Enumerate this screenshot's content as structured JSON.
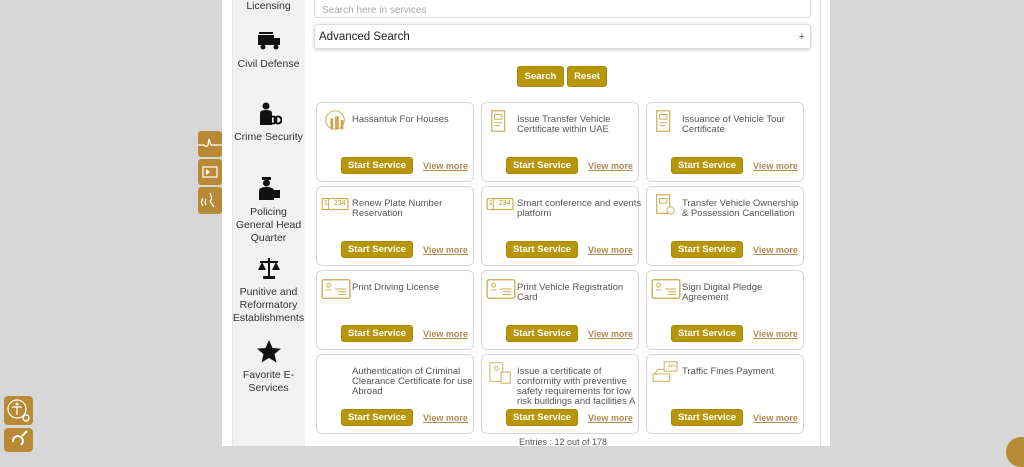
{
  "sidebar": {
    "items": [
      {
        "label": "Licensing",
        "icon": "licensing-icon"
      },
      {
        "label": "Civil Defense",
        "icon": "fire-truck-icon"
      },
      {
        "label": "Crime Security",
        "icon": "police-handcuffs-icon"
      },
      {
        "label": "Policing General Head Quarter",
        "icon": "police-officer-icon"
      },
      {
        "label": "Punitive and Reformatory Establishments",
        "icon": "scales-icon"
      },
      {
        "label": "Favorite E-Services",
        "icon": "star-icon"
      }
    ]
  },
  "search": {
    "placeholder": "Search here in services",
    "advanced_label": "Advanced Search",
    "expand_symbol": "+",
    "search_label": "Search",
    "reset_label": "Reset"
  },
  "services": [
    {
      "title": "Hassantuk For Houses",
      "icon": "hassantuk-icon"
    },
    {
      "title": "Issue Transfer Vehicle Certificate within UAE",
      "icon": "vehicle-certificate-icon"
    },
    {
      "title": "Issuance of Vehicle Tour Certificate",
      "icon": "vehicle-certificate-icon"
    },
    {
      "title": "Renew Plate Number Reservation",
      "icon": "plate-number-icon"
    },
    {
      "title": "Smart conference and events platform",
      "icon": "plate-number-icon"
    },
    {
      "title": "Transfer Vehicle Ownership & Possession Cancellation",
      "icon": "vehicle-ownership-icon"
    },
    {
      "title": "Print Driving License",
      "icon": "id-card-icon"
    },
    {
      "title": "Print Vehicle Registration Card",
      "icon": "id-card-icon"
    },
    {
      "title": "Sign Digital Pledge Agreement",
      "icon": "id-card-icon"
    },
    {
      "title": "Authentication of Criminal Clearance Certificate for use Abroad",
      "icon": ""
    },
    {
      "title": "Issue a certificate of conformity with preventive safety requirements for low risk buildings and facilities A",
      "icon": "building-certificate-icon"
    },
    {
      "title": "Traffic Fines Payment",
      "icon": "traffic-fines-icon"
    }
  ],
  "card_labels": {
    "start": "Start Service",
    "more": "View more",
    "plate": "1 234",
    "aed": "AED"
  },
  "entries": "Entries : 12 out of 178",
  "colors": {
    "accent": "#b8960a",
    "float": "#b98a35",
    "background": "#d7d7d7"
  }
}
